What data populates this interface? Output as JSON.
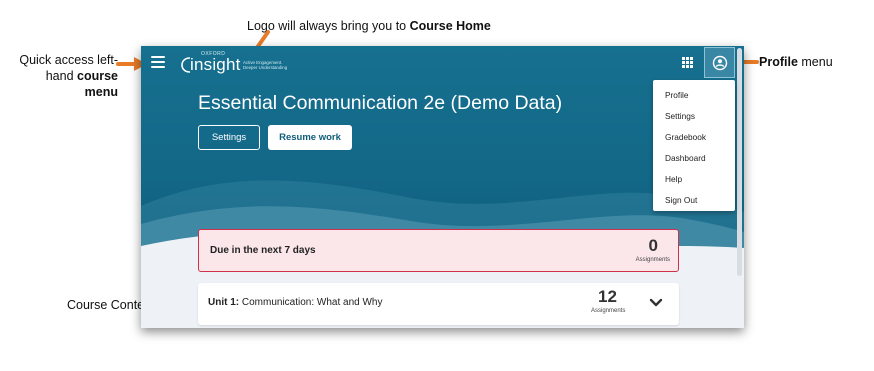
{
  "annotations": {
    "logo_note_prefix": "Logo will always bring you to ",
    "logo_note_bold": "Course Home",
    "menu_note_line1": "Quick access left-",
    "menu_note_line2_prefix": "hand ",
    "menu_note_line2_bold": "course menu",
    "profile_note_bold": "Profile",
    "profile_note_suffix": " menu",
    "contents_note": "Course Contents",
    "arrow_color": "#e87b27"
  },
  "app": {
    "logo_brand": "OXFORD",
    "logo_word": "insight",
    "logo_tagline_1": "Active Engagement.",
    "logo_tagline_2": "Deeper Understanding",
    "icons": {
      "menu": "hamburger-icon",
      "apps": "apps-grid-icon",
      "profile": "user-circle-icon",
      "expand": "chevron-down-icon"
    },
    "colors": {
      "header": "#136787",
      "accent": "#0f5c7a",
      "alert_border": "#d0314a"
    }
  },
  "hero": {
    "course_title": "Essential Communication 2e (Demo Data)",
    "settings_label": "Settings",
    "resume_label": "Resume work"
  },
  "profile_menu": {
    "items": [
      "Profile",
      "Settings",
      "Gradebook",
      "Dashboard",
      "Help",
      "Sign Out"
    ]
  },
  "due": {
    "label": "Due in the next 7 days",
    "count": "0",
    "count_unit": "Assignments"
  },
  "units": [
    {
      "prefix": "Unit 1:",
      "title": " Communication: What and Why",
      "count": "12",
      "count_unit": "Assignments"
    }
  ]
}
